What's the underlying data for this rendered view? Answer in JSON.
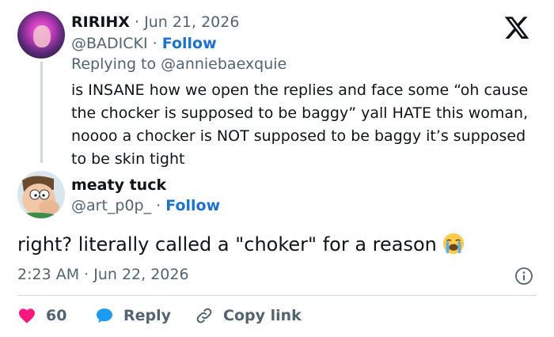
{
  "parent_tweet": {
    "display_name": "RIRIHX",
    "date": "Jun 21, 2026",
    "handle": "@BADICKI",
    "follow_label": "Follow",
    "replying_prefix": "Replying to",
    "replying_to": "@anniebaexquie",
    "text": "is INSANE how we open the replies and face some “oh cause the chocker is supposed to be baggy” yall HATE this woman, noooo a chocker is NOT supposed to be baggy it’s supposed to be skin tight"
  },
  "main_tweet": {
    "display_name": "meaty tuck",
    "handle": "@art_p0p_",
    "follow_label": "Follow",
    "text": "right? literally called a \"choker\" for a reason",
    "emoji": "loudly-crying-face",
    "timestamp": "2:23 AM · Jun 22, 2026"
  },
  "actions": {
    "like_count": "60",
    "reply_label": "Reply",
    "copy_link_label": "Copy link"
  },
  "separator": "·",
  "colors": {
    "like": "#f91880",
    "reply": "#1d9bf0",
    "link": "#1d72c9",
    "muted": "#536471"
  },
  "icons": [
    "x-logo-icon",
    "heart-icon",
    "reply-bubble-icon",
    "link-icon",
    "info-icon"
  ]
}
